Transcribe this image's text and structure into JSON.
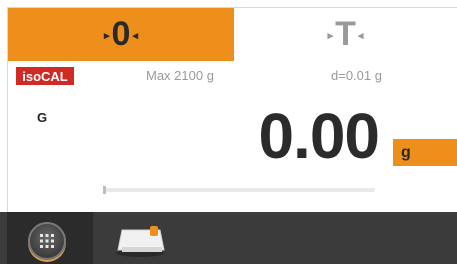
{
  "softkeys": {
    "zero": {
      "label": "0",
      "left_arrow": "▸",
      "right_arrow": "◂"
    },
    "tare": {
      "label": "T",
      "left_arrow": "▸",
      "right_arrow": "◂"
    }
  },
  "calibration": {
    "badge": "isoCAL"
  },
  "scale_info": {
    "max": "Max 2100 g",
    "readability": "d=0.01 g"
  },
  "weighing": {
    "mode": "G",
    "value": "0.00",
    "unit": "g",
    "capacity_bar_fraction": 0.0
  },
  "taskbar": {
    "menu_icon": "grid-menu-icon",
    "app_icon": "weighing-app-icon"
  },
  "colors": {
    "accent": "#ee8f1c",
    "badge": "#d02a25",
    "taskbar": "#3b3b3b"
  }
}
